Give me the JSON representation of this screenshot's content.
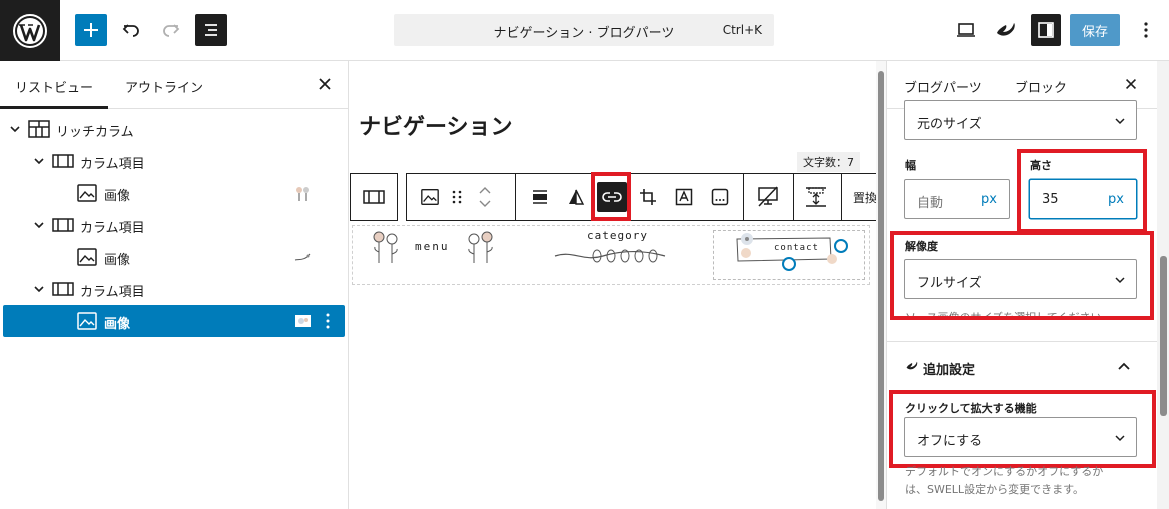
{
  "header": {
    "doc_title": "ナビゲーション · ブログパーツ",
    "shortcut": "Ctrl+K",
    "save_label": "保存",
    "icons": [
      "wordpress-logo",
      "plus-icon",
      "undo-icon",
      "redo-icon",
      "document-overview-icon",
      "desktop-preview-icon",
      "swell-icon",
      "settings-icon",
      "more-options-icon"
    ]
  },
  "list_view": {
    "tabs": [
      {
        "label": "リストビュー",
        "active": true
      },
      {
        "label": "アウトライン",
        "active": false
      }
    ],
    "items": [
      {
        "label": "リッチカラム",
        "icon": "columns-icon",
        "level": 0,
        "expanded": true
      },
      {
        "label": "カラム項目",
        "icon": "column-icon",
        "level": 1,
        "expanded": true
      },
      {
        "label": "画像",
        "icon": "image-icon",
        "level": 2
      },
      {
        "label": "カラム項目",
        "icon": "column-icon",
        "level": 1,
        "expanded": true
      },
      {
        "label": "画像",
        "icon": "image-icon",
        "level": 2
      },
      {
        "label": "カラム項目",
        "icon": "column-icon",
        "level": 1,
        "expanded": true
      },
      {
        "label": "画像",
        "icon": "image-icon",
        "level": 2,
        "selected": true
      }
    ]
  },
  "canvas": {
    "heading": "ナビゲーション",
    "word_count": "文字数：7",
    "toolbar_overflow_label": "置換",
    "images": {
      "menu": "menu",
      "category": "category",
      "contact": "contact"
    }
  },
  "sidebar": {
    "tabs": [
      {
        "label": "ブログパーツ",
        "active": false
      },
      {
        "label": "ブロック",
        "active": true
      }
    ],
    "size_select": "元のサイズ",
    "width_label": "幅",
    "width_placeholder": "自動",
    "width_unit": "px",
    "height_label": "高さ",
    "height_value": "35",
    "height_unit": "px",
    "resolution_label": "解像度",
    "resolution_value": "フルサイズ",
    "resolution_help": "ソース画像のサイズを選択してください。",
    "extra_settings_title": "追加設定",
    "lightbox_label": "クリックして拡大する機能",
    "lightbox_value": "オフにする",
    "lightbox_help_1": "デフォルトでオンにするかオフにするか",
    "lightbox_help_2": "は、SWELL設定から変更できます。"
  },
  "colors": {
    "accent": "#007cba",
    "highlight": "#e01b24",
    "dark": "#1e1e1e"
  }
}
